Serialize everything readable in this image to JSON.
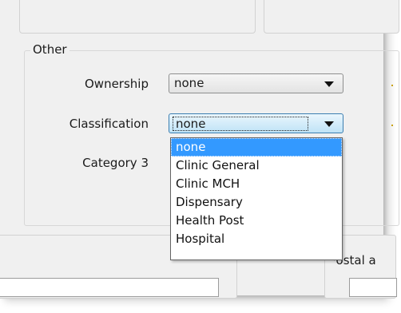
{
  "group": {
    "title": "Other"
  },
  "fields": {
    "ownership": {
      "label": "Ownership",
      "value": "none"
    },
    "classification": {
      "label": "Classification",
      "value": "none"
    },
    "category3": {
      "label": "Category 3"
    }
  },
  "dropdown": {
    "options": [
      "none",
      "Clinic General",
      "Clinic MCH",
      "Dispensary",
      "Health Post",
      "Hospital"
    ],
    "selected": "none"
  },
  "postal": {
    "label": "Postal a"
  },
  "icons": {
    "dropdown_arrow": "chevron-down-icon"
  },
  "colors": {
    "selection": "#3399ff",
    "window_bg": "#f0f0f0"
  }
}
